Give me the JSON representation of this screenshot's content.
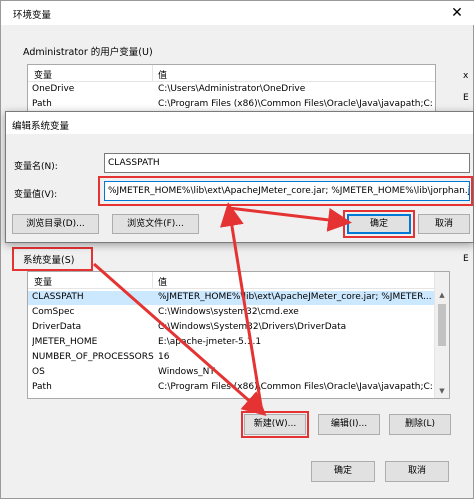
{
  "window": {
    "title": "环境变量",
    "close_glyph": "✕"
  },
  "user_vars": {
    "group_label": "Administrator 的用户变量(U)",
    "col_var": "变量",
    "col_val": "值",
    "rows": [
      {
        "name": "OneDrive",
        "value": "C:\\Users\\Administrator\\OneDrive"
      },
      {
        "name": "Path",
        "value": "C:\\Program Files (x86)\\Common Files\\Oracle\\Java\\javapath;C:..."
      }
    ]
  },
  "edit_dialog": {
    "title": "编辑系统变量",
    "name_label": "变量名(N):",
    "name_value": "CLASSPATH",
    "value_label": "变量值(V):",
    "value_value": "%JMETER_HOME%\\lib\\ext\\ApacheJMeter_core.jar; %JMETER_HOME%\\lib\\jorphan.ja",
    "browse_dir": "浏览目录(D)...",
    "browse_file": "浏览文件(F)...",
    "ok": "确定",
    "cancel": "取消"
  },
  "sys_vars": {
    "group_label": "系统变量(S)",
    "col_var": "变量",
    "col_val": "值",
    "rows": [
      {
        "name": "CLASSPATH",
        "value": "%JMETER_HOME%\\lib\\ext\\ApacheJMeter_core.jar; %JMETER..."
      },
      {
        "name": "ComSpec",
        "value": "C:\\Windows\\system32\\cmd.exe"
      },
      {
        "name": "DriverData",
        "value": "C:\\Windows\\System32\\Drivers\\DriverData"
      },
      {
        "name": "JMETER_HOME",
        "value": "E:\\apache-jmeter-5.1.1"
      },
      {
        "name": "NUMBER_OF_PROCESSORS",
        "value": "16"
      },
      {
        "name": "OS",
        "value": "Windows_NT"
      },
      {
        "name": "Path",
        "value": "C:\\Program Files (x86)\\Common Files\\Oracle\\Java\\javapath;C:..."
      }
    ],
    "new_btn": "新建(W)...",
    "edit_btn": "编辑(I)...",
    "delete_btn": "删除(L)"
  },
  "footer": {
    "ok": "确定",
    "cancel": "取消"
  },
  "edge_fragments": [
    "x",
    "E",
    "E"
  ],
  "colors": {
    "accent": "#0078d7",
    "selection": "#cce8ff",
    "annotation_red": "#e53333"
  }
}
